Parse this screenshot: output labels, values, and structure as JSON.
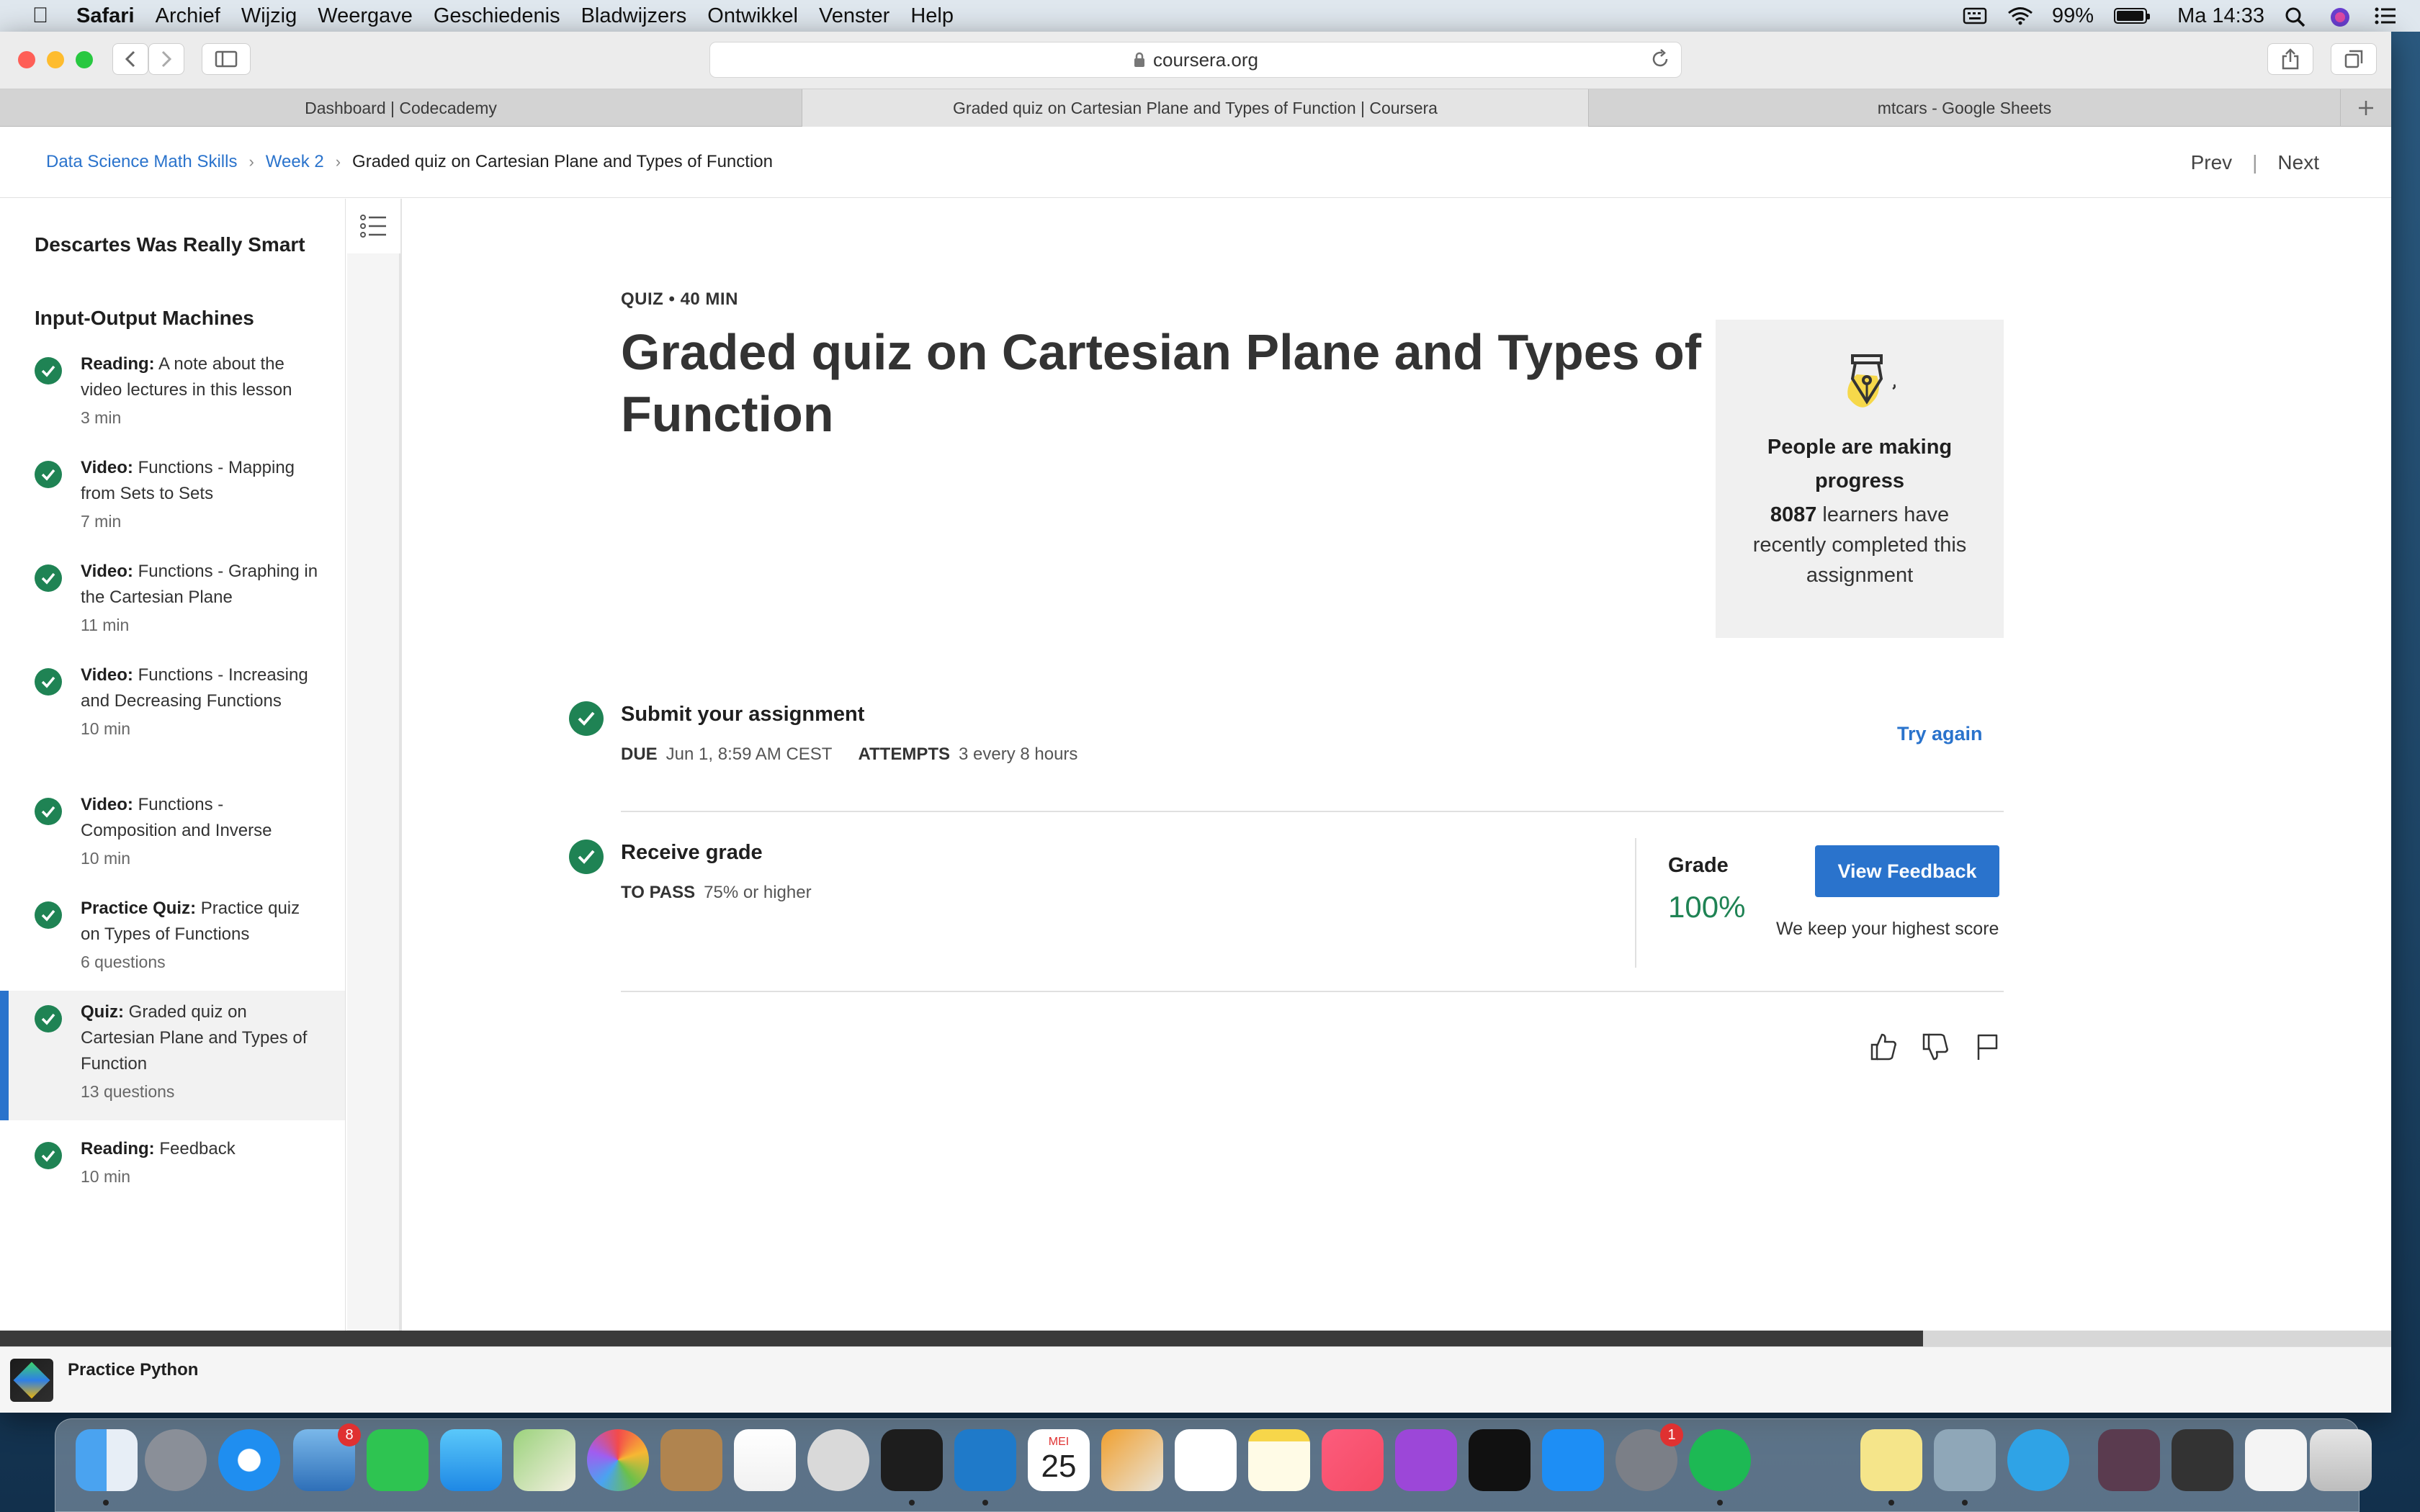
{
  "menubar": {
    "app_name": "Safari",
    "items": [
      "Archief",
      "Wijzig",
      "Weergave",
      "Geschiedenis",
      "Bladwijzers",
      "Ontwikkel",
      "Venster",
      "Help"
    ],
    "battery": "99%",
    "clock": "Ma 14:33"
  },
  "browser": {
    "address": "coursera.org",
    "tabs": [
      {
        "title": "Dashboard | Codecademy",
        "active": false
      },
      {
        "title": "Graded quiz on Cartesian Plane and Types of Function | Coursera",
        "active": true
      },
      {
        "title": "mtcars - Google Sheets",
        "active": false
      }
    ]
  },
  "breadcrumb": {
    "course": "Data Science Math Skills",
    "week": "Week 2",
    "current": "Graded quiz on Cartesian Plane and Types of Function",
    "prev": "Prev",
    "next": "Next",
    "divider": "|"
  },
  "sidebar": {
    "lesson": "Descartes Was Really Smart",
    "section": "Input-Output Machines",
    "items": [
      {
        "kind": "Reading:",
        "title": "A note about the video lectures in this lesson",
        "meta": "3 min"
      },
      {
        "kind": "Video:",
        "title": "Functions - Mapping from Sets to Sets",
        "meta": "7 min"
      },
      {
        "kind": "Video:",
        "title": "Functions - Graphing in the Cartesian Plane",
        "meta": "11 min"
      },
      {
        "kind": "Video:",
        "title": "Functions - Increasing and Decreasing Functions",
        "meta": "10 min"
      },
      {
        "kind": "Video:",
        "title": "Functions - Composition and Inverse",
        "meta": "10 min"
      },
      {
        "kind": "Practice Quiz:",
        "title": "Practice quiz on Types of Functions",
        "meta": "6 questions"
      },
      {
        "kind": "Quiz:",
        "title": "Graded quiz on Cartesian Plane and Types of Function",
        "meta": "13 questions"
      },
      {
        "kind": "Reading:",
        "title": "Feedback",
        "meta": "10 min"
      }
    ]
  },
  "quiz": {
    "eyebrow": "QUIZ • 40 MIN",
    "title": "Graded quiz on Cartesian Plane and Types of Function",
    "progress_card": {
      "heading": "People are making progress",
      "count": "8087",
      "text": "learners have recently completed this assignment"
    },
    "submit": {
      "title": "Submit your assignment",
      "due_label": "DUE",
      "due_value": "Jun 1, 8:59 AM CEST",
      "attempts_label": "ATTEMPTS",
      "attempts_value": "3 every 8 hours",
      "action": "Try again"
    },
    "grade": {
      "title": "Receive grade",
      "pass_label": "TO PASS",
      "pass_value": "75% or higher",
      "grade_label": "Grade",
      "grade_value": "100%",
      "button": "View Feedback",
      "note": "We keep your highest score"
    }
  },
  "statusbar": {
    "label": "Practice Python"
  },
  "dock": {
    "badges": {
      "mail": "8",
      "system_preferences": "1"
    },
    "calendar": {
      "month": "MEI",
      "day": "25"
    }
  },
  "colors": {
    "accent": "#2a73cc",
    "success": "#1f8354",
    "card": "#f0f0f0"
  }
}
